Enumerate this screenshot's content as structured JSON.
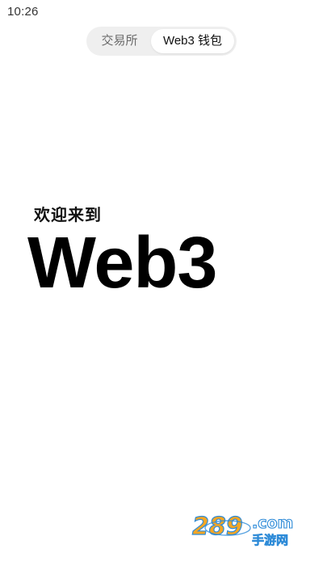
{
  "status_bar": {
    "time": "10:26"
  },
  "mode_switch": {
    "tabs": [
      {
        "label": "交易所",
        "active": false
      },
      {
        "label": "Web3 钱包",
        "active": true
      }
    ]
  },
  "welcome": {
    "subtitle": "欢迎来到",
    "title": "Web3"
  },
  "watermark": {
    "text": "289.com 手游网"
  },
  "colors": {
    "background": "#ffffff",
    "switch_bg": "#efefef",
    "active_tab_bg": "#ffffff",
    "inactive_tab_text": "#6b6b6b",
    "primary_text": "#111111",
    "watermark_orange": "#f5a623",
    "watermark_blue": "#2e8bd8"
  }
}
